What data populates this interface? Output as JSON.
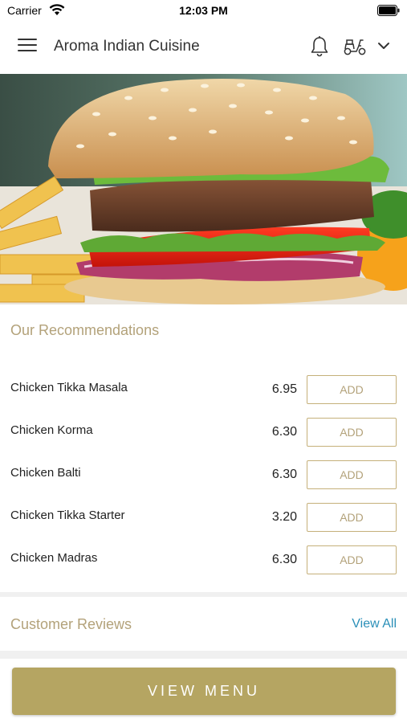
{
  "status_bar": {
    "carrier": "Carrier",
    "time": "12:03 PM"
  },
  "header": {
    "title": "Aroma Indian Cuisine",
    "icons": [
      "menu-icon",
      "bell-icon",
      "scooter-icon",
      "chevron-down-icon"
    ]
  },
  "hero": {
    "image": "burger-image"
  },
  "recommendations": {
    "title": "Our Recommendations",
    "items": [
      {
        "name": "Chicken Tikka Masala",
        "price": "6.95",
        "button": "ADD"
      },
      {
        "name": "Chicken Korma",
        "price": "6.30",
        "button": "ADD"
      },
      {
        "name": "Chicken Balti",
        "price": "6.30",
        "button": "ADD"
      },
      {
        "name": "Chicken Tikka Starter",
        "price": "3.20",
        "button": "ADD"
      },
      {
        "name": "Chicken Madras",
        "price": "6.30",
        "button": "ADD"
      }
    ]
  },
  "reviews": {
    "title": "Customer Reviews",
    "link": "View All"
  },
  "footer": {
    "button": "VIEW MENU"
  },
  "colors": {
    "accent_gold": "#b5a562",
    "section_title": "#b3a27a",
    "link_blue": "#2a8fb8"
  }
}
